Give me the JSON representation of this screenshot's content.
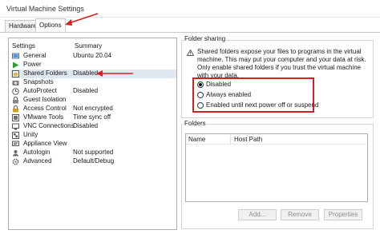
{
  "window": {
    "title": "Virtual Machine Settings"
  },
  "tabs": [
    {
      "label": "Hardware",
      "active": false
    },
    {
      "label": "Options",
      "active": true
    }
  ],
  "settings": {
    "header": {
      "settings": "Settings",
      "summary": "Summary"
    },
    "items": [
      {
        "name": "General",
        "summary": "Ubuntu 20.04",
        "icon": "general-icon"
      },
      {
        "name": "Power",
        "summary": "",
        "icon": "power-icon"
      },
      {
        "name": "Shared Folders",
        "summary": "Disabled",
        "icon": "shared-folders-icon",
        "selected": true
      },
      {
        "name": "Snapshots",
        "summary": "",
        "icon": "snapshots-icon"
      },
      {
        "name": "AutoProtect",
        "summary": "Disabled",
        "icon": "autoprotect-icon"
      },
      {
        "name": "Guest Isolation",
        "summary": "",
        "icon": "guest-isolation-icon"
      },
      {
        "name": "Access Control",
        "summary": "Not encrypted",
        "icon": "access-control-icon"
      },
      {
        "name": "VMware Tools",
        "summary": "Time sync off",
        "icon": "vmware-tools-icon"
      },
      {
        "name": "VNC Connections",
        "summary": "Disabled",
        "icon": "vnc-icon"
      },
      {
        "name": "Unity",
        "summary": "",
        "icon": "unity-icon"
      },
      {
        "name": "Appliance View",
        "summary": "",
        "icon": "appliance-view-icon"
      },
      {
        "name": "Autologin",
        "summary": "Not supported",
        "icon": "autologin-icon"
      },
      {
        "name": "Advanced",
        "summary": "Default/Debug",
        "icon": "advanced-icon"
      }
    ]
  },
  "folder_sharing": {
    "label": "Folder sharing",
    "warning": "Shared folders expose your files to programs in the virtual machine. This may put your computer and your data at risk. Only enable shared folders if you trust the virtual machine with your data.",
    "options": [
      {
        "label": "Disabled",
        "selected": true
      },
      {
        "label": "Always enabled",
        "selected": false
      },
      {
        "label": "Enabled until next power off or suspend",
        "selected": false
      }
    ]
  },
  "folders": {
    "label": "Folders",
    "columns": [
      "Name",
      "Host Path"
    ],
    "rows": [],
    "buttons": {
      "add": "Add...",
      "remove": "Remove",
      "properties": "Properties"
    }
  },
  "colors": {
    "annotation_red": "#d42020",
    "selection": "#dfe7f1"
  }
}
